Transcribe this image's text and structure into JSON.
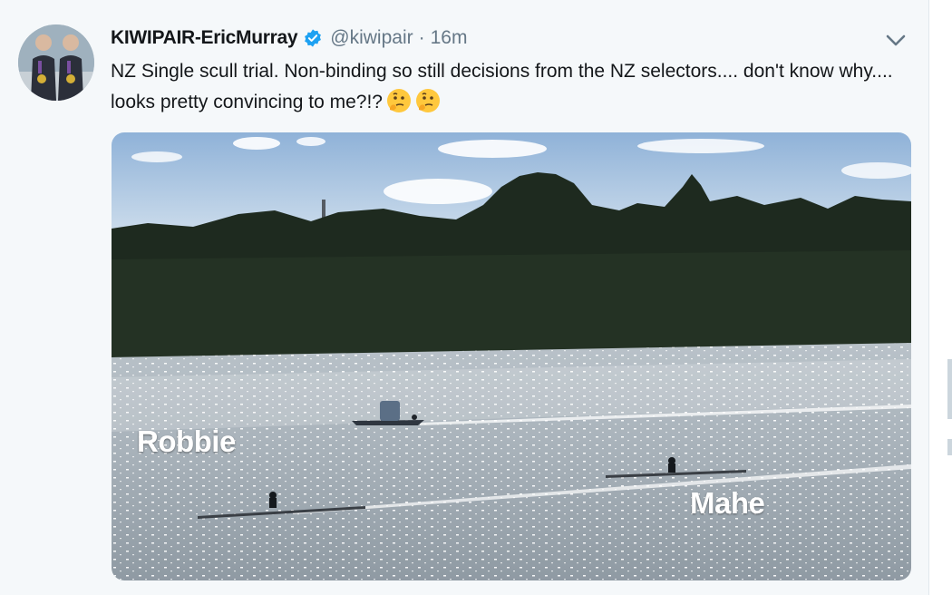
{
  "tweet": {
    "display_name": "KIWIPAIR-EricMurray",
    "verified_icon": "verified-badge-icon",
    "handle": "@kiwipair",
    "separator": "·",
    "time": "16m",
    "text": "NZ Single scull trial. Non-binding so still decisions from the NZ selectors.... don't know why.... looks pretty convincing to me?!?",
    "emoji": [
      "thinking-face-emoji",
      "thinking-face-emoji"
    ],
    "menu_icon": "chevron-down-icon"
  },
  "media": {
    "label_left": "Robbie",
    "label_right": "Mahe"
  },
  "colors": {
    "background": "#f5f8fa",
    "text": "#14171a",
    "secondary": "#657786",
    "verified": "#1da1f2"
  }
}
